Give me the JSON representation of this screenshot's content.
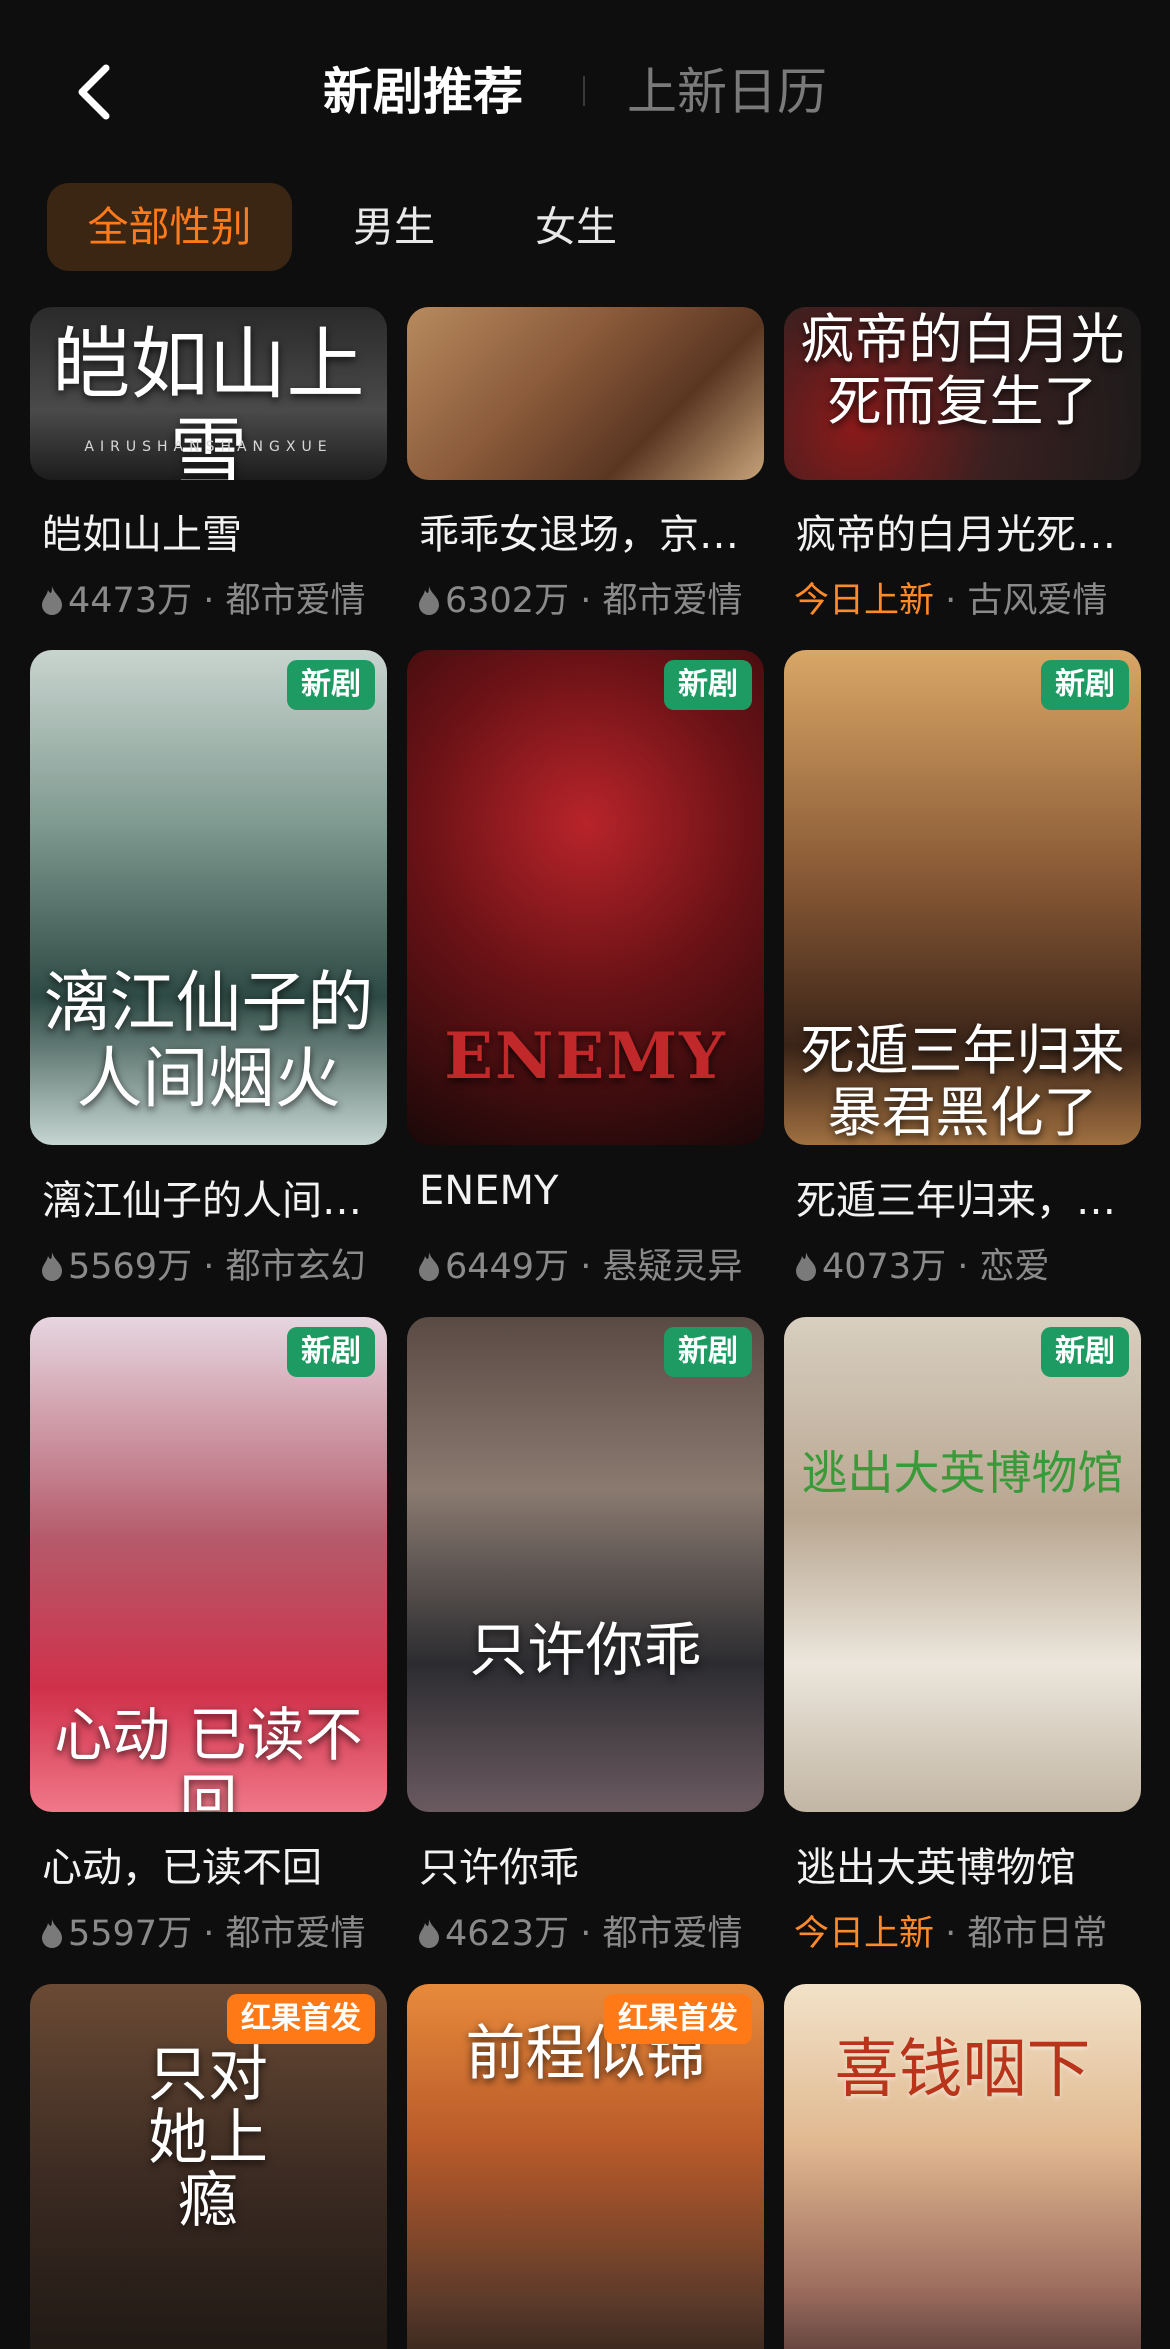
{
  "header": {
    "tabs": [
      {
        "label": "新剧推荐",
        "active": true
      },
      {
        "label": "上新日历",
        "active": false
      }
    ]
  },
  "filters": [
    {
      "label": "全部性别",
      "active": true
    },
    {
      "label": "男生",
      "active": false
    },
    {
      "label": "女生",
      "active": false
    }
  ],
  "colors": {
    "accent": "#ff7a1a",
    "badge_new": "#1e9a63",
    "badge_red": "#ff7a16",
    "background": "#0e0e0e"
  },
  "icons": {
    "back": "chevron-left-icon",
    "heat": "flame-icon"
  },
  "rows": [
    {
      "cards": [
        {
          "title": "皑如山上雪",
          "poster_text": "皑如山上雪",
          "poster_subtext": "AIRUSHANSHANGXUE",
          "heat": "4473万",
          "genre": "都市爱情",
          "badge": ""
        },
        {
          "title": "乖乖女退场，京…",
          "poster_text": "",
          "poster_subtext": "",
          "heat": "6302万",
          "genre": "都市爱情",
          "badge": ""
        },
        {
          "title": "疯帝的白月光死…",
          "poster_text": "疯帝的白月光 死而复生了",
          "poster_subtext": "",
          "today_label": "今日上新",
          "genre": "古风爱情",
          "badge": ""
        }
      ]
    },
    {
      "cards": [
        {
          "title": "漓江仙子的人间…",
          "poster_text": "漓江仙子的 人间烟火",
          "poster_subtext": "",
          "heat": "5569万",
          "genre": "都市玄幻",
          "badge": "新剧"
        },
        {
          "title": "ENEMY",
          "poster_text": "ENEMY",
          "poster_subtext": "",
          "heat": "6449万",
          "genre": "悬疑灵异",
          "badge": "新剧"
        },
        {
          "title": "死遁三年归来，…",
          "poster_text": "死遁三年归来 暴君黑化了",
          "poster_subtext": "",
          "heat": "4073万",
          "genre": "恋爱",
          "badge": "新剧"
        }
      ]
    },
    {
      "cards": [
        {
          "title": "心动，已读不回",
          "poster_text": "心动 已读不回",
          "poster_subtext": "",
          "heat": "5597万",
          "genre": "都市爱情",
          "badge": "新剧"
        },
        {
          "title": "只许你乖",
          "poster_text": "只许你乖",
          "poster_subtext": "",
          "heat": "4623万",
          "genre": "都市爱情",
          "badge": "新剧"
        },
        {
          "title": "逃出大英博物馆",
          "poster_text": "逃出大英博物馆",
          "poster_subtext": "",
          "today_label": "今日上新",
          "genre": "都市日常",
          "badge": "新剧"
        }
      ]
    },
    {
      "cards": [
        {
          "title": "",
          "poster_text": "只对她上瘾",
          "poster_subtext": "",
          "heat": "",
          "genre": "",
          "badge": "红果首发"
        },
        {
          "title": "",
          "poster_text": "前程似锦",
          "poster_subtext": "",
          "heat": "",
          "genre": "",
          "badge": "红果首发"
        },
        {
          "title": "",
          "poster_text": "喜钱咽下",
          "poster_subtext": "",
          "heat": "",
          "genre": "",
          "badge": ""
        }
      ]
    }
  ]
}
